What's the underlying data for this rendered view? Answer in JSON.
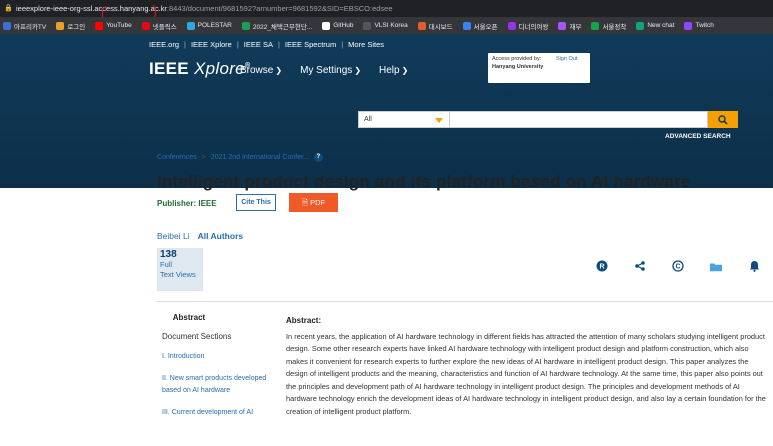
{
  "browser": {
    "url_host": "ieeexplore-ieee-org-ssl.access.hanyang.ac.kr",
    "url_path": ":8443/document/9681592?arnumber=9681592&SID=EBSCO:edsee",
    "bookmarks": [
      {
        "label": "아프리카TV",
        "icon": "afreeca-icon",
        "color": "#3a6fd8"
      },
      {
        "label": "로그인",
        "icon": "login-icon",
        "color": "#e7a227"
      },
      {
        "label": "YouTube",
        "icon": "youtube-icon",
        "color": "#ff0000"
      },
      {
        "label": "넷플릭스",
        "icon": "netflix-icon",
        "color": "#e50914"
      },
      {
        "label": "POLESTAR",
        "icon": "polestar-icon",
        "color": "#2ea8e0"
      },
      {
        "label": "2022_채택근무현단...",
        "icon": "gdocs-icon",
        "color": "#1f9d55"
      },
      {
        "label": "GitHub",
        "icon": "github-icon",
        "color": "#ffffff"
      },
      {
        "label": "VLSI Korea",
        "icon": "vlsi-icon",
        "color": "#555555"
      },
      {
        "label": "대시보드",
        "icon": "dashboard-icon",
        "color": "#e65c2b"
      },
      {
        "label": "서울오픈",
        "icon": "seoul-icon",
        "color": "#3b82f6"
      },
      {
        "label": "디너의여왕",
        "icon": "dinner-icon",
        "color": "#9333ea"
      },
      {
        "label": "재부",
        "icon": "jaebu-icon",
        "color": "#a855f7"
      },
      {
        "label": "서울정착",
        "icon": "settle-icon",
        "color": "#16a34a"
      },
      {
        "label": "New chat",
        "icon": "chat-icon",
        "color": "#10a37f"
      },
      {
        "label": "Twitch",
        "icon": "twitch-icon",
        "color": "#9146ff"
      }
    ]
  },
  "header": {
    "topnav": [
      "IEEE.org",
      "IEEE Xplore",
      "IEEE SA",
      "IEEE Spectrum",
      "More Sites"
    ],
    "brand_ieee": "IEEE",
    "brand_xplore": "Xplore",
    "brand_reg": "®",
    "nav": [
      "Browse",
      "My Settings",
      "Help"
    ],
    "access_label": "Access provided by:",
    "access_inst": "Hanyang University",
    "sign_out": "Sign Out",
    "search_scope": "All",
    "search_placeholder": "",
    "advanced": "ADVANCED SEARCH"
  },
  "breadcrumb": {
    "root": "Conferences",
    "sep": ">",
    "current": "2021 2nd International Confer..."
  },
  "article": {
    "title": "Intelligent product design and its platform based on AI hardware",
    "publisher_label": "Publisher:",
    "publisher": "IEEE",
    "cite_label": "Cite This",
    "pdf_label": "PDF",
    "author": "Beibei Li",
    "all_authors": "All Authors",
    "views_count": "138",
    "views_label_1": "Full",
    "views_label_2": "Text Views"
  },
  "sections": {
    "abstract_tab": "Abstract",
    "doc_sections": "Document Sections",
    "items": [
      "I. Introduction",
      "II. New smart products developed based on AI hardware",
      "III. Current development of AI"
    ]
  },
  "abstract": {
    "heading": "Abstract:",
    "text": "In recent years, the application of AI hardware technology in different fields has attracted the attention of many scholars studying intelligent product design. Some other research experts have linked AI hardware technology with intelligent product design and platform construction, which also makes it convenient for research experts to further explore the new ideas of AI hardware in intelligent product design. This paper analyzes the design of intelligent products and the meaning, characteristics and function of AI hardware technology. At the same time, this paper also points out the principles and development path of AI hardware technology in intelligent product design. The principles and development methods of AI hardware technology enrich the development ideas of AI hardware technology in intelligent product design, and also lay a certain foundation for the creation of intelligent product platform."
  },
  "colors": {
    "header_bg": "#103b5a",
    "accent_orange": "#f6a000",
    "pdf_red": "#f05a28",
    "link_blue": "#2b6cb0",
    "publisher_green": "#1f6b35"
  }
}
